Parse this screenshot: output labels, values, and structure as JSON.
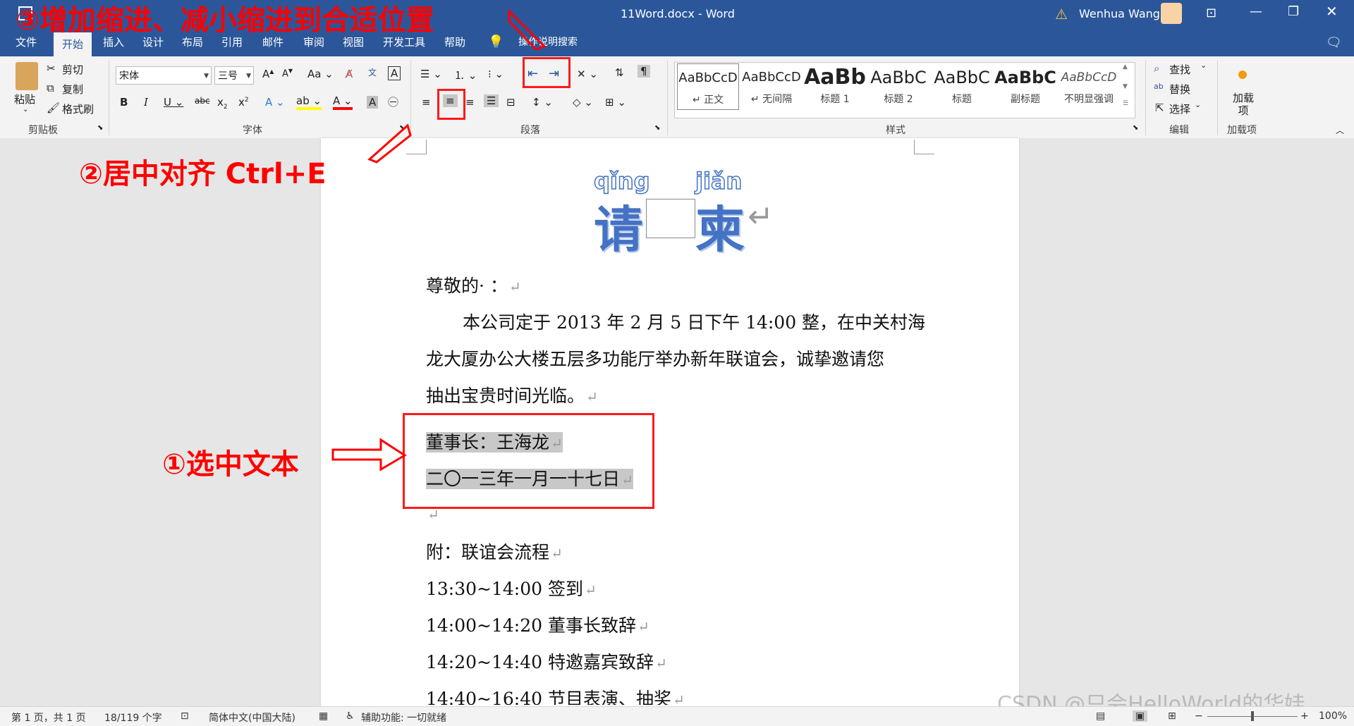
{
  "titlebar": {
    "doc_title": "11Word.docx - Word",
    "user_name": "Wenhua Wang"
  },
  "menu": [
    "文件",
    "开始",
    "插入",
    "设计",
    "布局",
    "引用",
    "邮件",
    "审阅",
    "视图",
    "开发工具",
    "帮助",
    "操作说明搜索"
  ],
  "ribbon": {
    "clipboard": {
      "paste": "粘贴",
      "cut": "剪切",
      "copy": "复制",
      "format_painter": "格式刷",
      "label": "剪贴板"
    },
    "font": {
      "font_name": "宋体",
      "font_size": "三号",
      "label": "字体"
    },
    "paragraph": {
      "label": "段落"
    },
    "styles": {
      "label": "样式",
      "items": [
        {
          "sample": "AaBbCcD",
          "name": "↵ 正文"
        },
        {
          "sample": "AaBbCcD",
          "name": "↵ 无间隔"
        },
        {
          "sample": "AaBb",
          "name": "标题 1"
        },
        {
          "sample": "AaBbC",
          "name": "标题 2"
        },
        {
          "sample": "AaBbC",
          "name": "标题"
        },
        {
          "sample": "AaBbC",
          "name": "副标题"
        },
        {
          "sample": "AaBbCcD",
          "name": "不明显强调"
        }
      ]
    },
    "editing": {
      "find": "查找",
      "replace": "替换",
      "select": "选择",
      "label": "编辑"
    },
    "addins": {
      "btn": "加载项",
      "label": "加载项"
    }
  },
  "document": {
    "ruby": [
      "qǐng",
      "jiǎn"
    ],
    "title_chars": [
      "请",
      "柬"
    ],
    "line1": "尊敬的· ：",
    "para1": [
      "本公司定于 2013 年 2 月 5 日下午 14:00 整，在中关村海",
      "龙大厦办公大楼五层多功能厅举办新年联谊会，诚挚邀请您",
      "抽出宝贵时间光临。"
    ],
    "sign1": "董事长：王海龙",
    "sign2": "二〇一三年一月一十七日",
    "attach": "附：联谊会流程",
    "schedule": [
      "13:30~14:00 签到",
      "14:00~14:20 董事长致辞",
      "14:20~14:40 特邀嘉宾致辞",
      "14:40~16:40 节目表演、抽奖"
    ],
    "para_mark": "↵"
  },
  "annotations": {
    "a1": "①选中文本",
    "a2": "②居中对齐 Ctrl+E",
    "a3": "③增加缩进、减小缩进到合适位置"
  },
  "statusbar": {
    "page": "第 1 页，共 1 页",
    "words": "18/119 个字",
    "lang": "简体中文(中国大陆)",
    "access": "辅助功能: 一切就绪",
    "zoom": "100%"
  },
  "watermark": "CSDN @只会HelloWorld的华娃"
}
